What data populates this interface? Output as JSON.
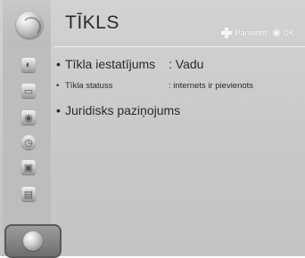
{
  "header": {
    "title": "TĪKLS",
    "hint_move": "Pārvietot",
    "hint_ok": "OK"
  },
  "menu": {
    "items": [
      {
        "label": "Tīkla iestatījums",
        "value": ": Vadu"
      },
      {
        "label": "Tīkla statuss",
        "value": ": internets ir pievienots"
      },
      {
        "label": "Juridisks paziņojums"
      }
    ]
  },
  "sidebar": {
    "items": [
      {
        "icon": "picture-icon"
      },
      {
        "icon": "screen-icon"
      },
      {
        "icon": "speaker-icon"
      },
      {
        "icon": "clock-icon"
      },
      {
        "icon": "lock-icon"
      },
      {
        "icon": "options-icon"
      },
      {
        "icon": "network-globe-icon",
        "selected": true
      }
    ]
  },
  "colors": {
    "background": "#cacaca",
    "title_text": "#2b2b2b",
    "selected_tab": "#7a7a7a"
  }
}
